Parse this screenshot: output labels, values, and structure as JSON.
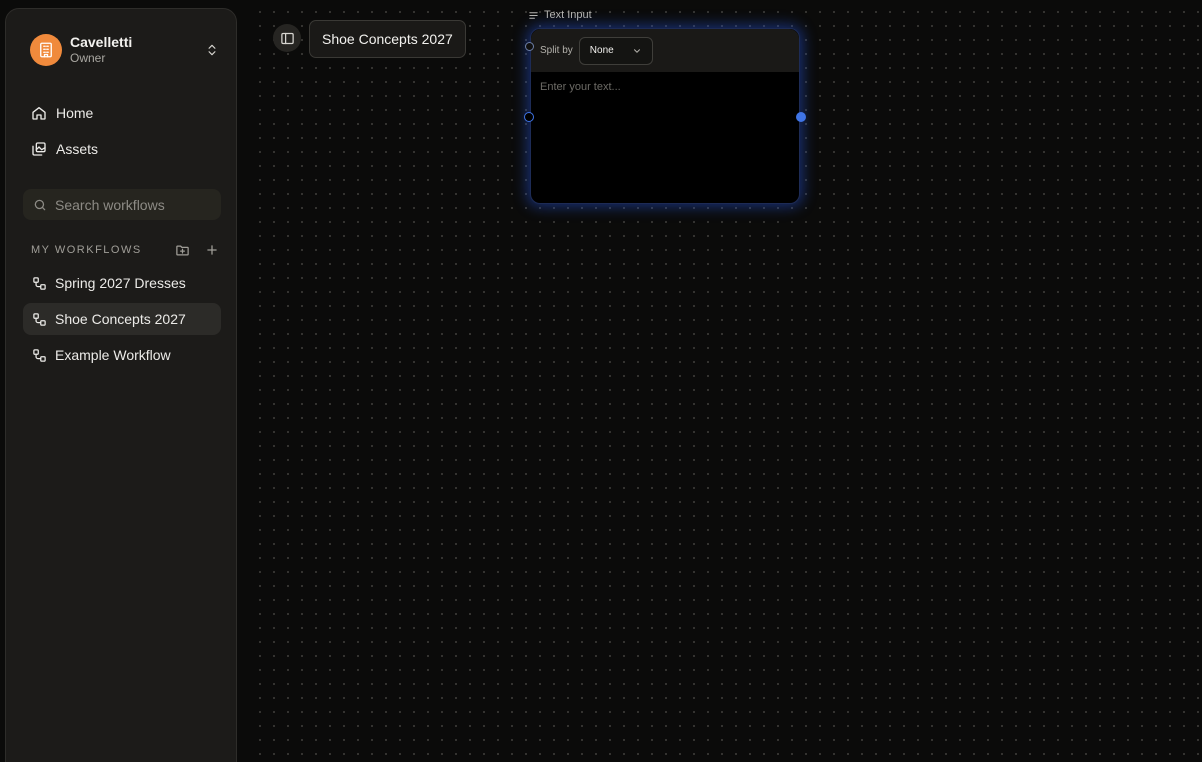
{
  "org": {
    "name": "Cavelletti",
    "role": "Owner"
  },
  "nav": {
    "home": "Home",
    "assets": "Assets"
  },
  "search": {
    "placeholder": "Search workflows"
  },
  "workflows": {
    "title": "MY WORKFLOWS",
    "items": [
      {
        "label": "Spring 2027 Dresses"
      },
      {
        "label": "Shoe Concepts 2027"
      },
      {
        "label": "Example Workflow"
      }
    ],
    "active_index": 1
  },
  "canvas": {
    "workflow_title": "Shoe Concepts 2027",
    "node": {
      "label": "Text Input",
      "split_label": "Split by",
      "split_value": "None",
      "text_placeholder": "Enter your text..."
    }
  },
  "colors": {
    "accent_orange": "#f08a3c",
    "handle_blue": "#3f74e6",
    "node_glow": "#285af0"
  }
}
